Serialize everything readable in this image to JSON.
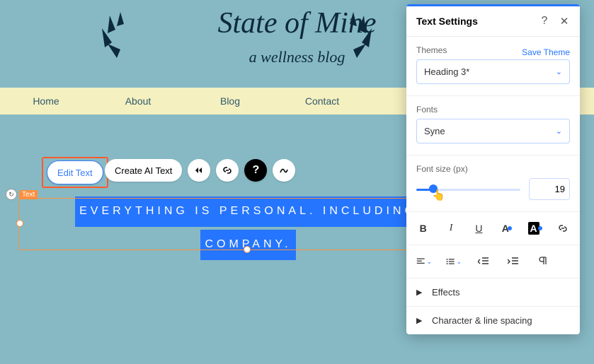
{
  "header": {
    "title": "State of Mine",
    "subtitle": "a wellness blog"
  },
  "nav": [
    "Home",
    "About",
    "Blog",
    "Contact"
  ],
  "toolbar": {
    "edit": "Edit Text",
    "ai": "Create AI Text"
  },
  "textlabel": "Text",
  "content": {
    "line1": "EVERYTHING IS PERSONAL. INCLUDING",
    "line2": "COMPANY."
  },
  "panel": {
    "title": "Text Settings",
    "themes": {
      "label": "Themes",
      "save": "Save Theme",
      "value": "Heading 3*"
    },
    "fonts": {
      "label": "Fonts",
      "value": "Syne"
    },
    "size": {
      "label": "Font size (px)",
      "value": "19"
    },
    "effects": "Effects",
    "spacing": "Character & line spacing"
  }
}
